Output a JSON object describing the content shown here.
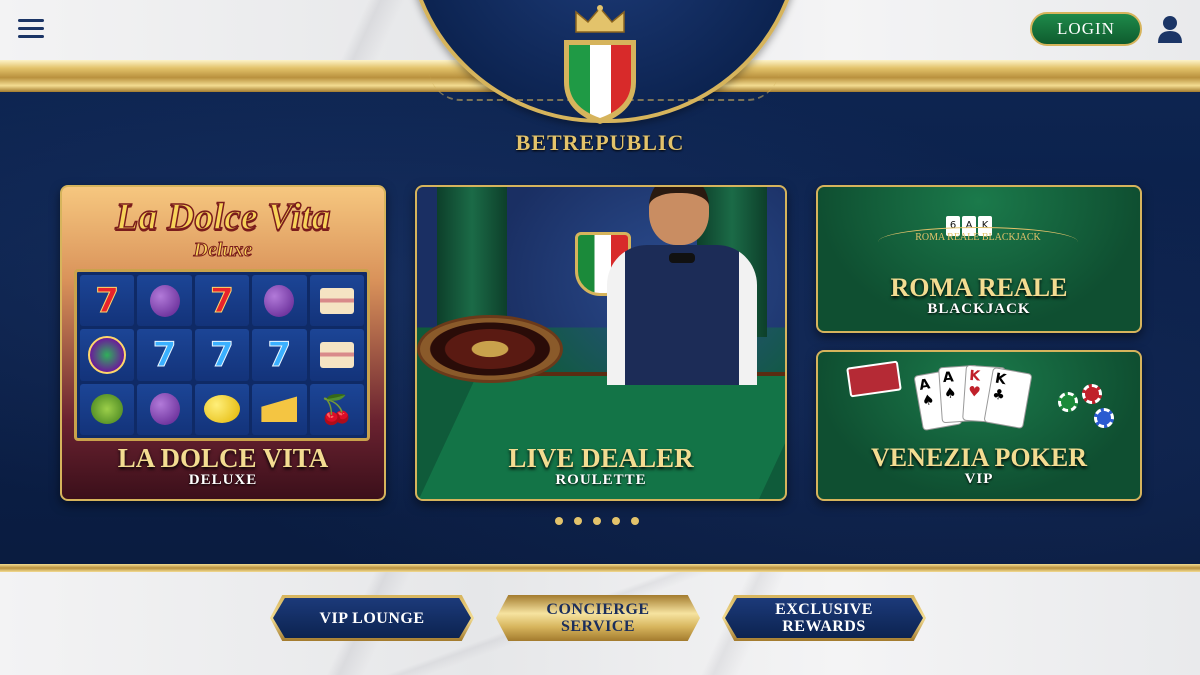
{
  "header": {
    "menu_icon": "hamburger-icon",
    "login_label": "LOGIN",
    "user_icon": "user-icon",
    "brand": "BETREPUBLIC",
    "crest_icon": "italian-crown-shield-icon"
  },
  "carousel": {
    "cards": [
      {
        "logo": "La Dolce Vita",
        "logo_sub": "Deluxe",
        "title": "LA DOLCE VITA",
        "subtitle": "DELUXE"
      },
      {
        "title": "LIVE DEALER",
        "subtitle": "ROULETTE"
      },
      {
        "table_text": "ROMA REALE BLACKJACK",
        "title": "ROMA REALE",
        "subtitle": "BLACKJACK"
      },
      {
        "title": "VENEZIA POKER",
        "subtitle": "VIP"
      }
    ],
    "dot_count": 5
  },
  "footer_buttons": [
    {
      "label": "VIP LOUNGE"
    },
    {
      "label_line1": "CONCIERGE",
      "label_line2": "SERVICE"
    },
    {
      "label_line1": "EXCLUSIVE",
      "label_line2": "REWARDS"
    }
  ],
  "colors": {
    "navy": "#0b1f47",
    "gold": "#d6b45c",
    "login_green": "#1e8a4a",
    "felt_green": "#137447"
  }
}
